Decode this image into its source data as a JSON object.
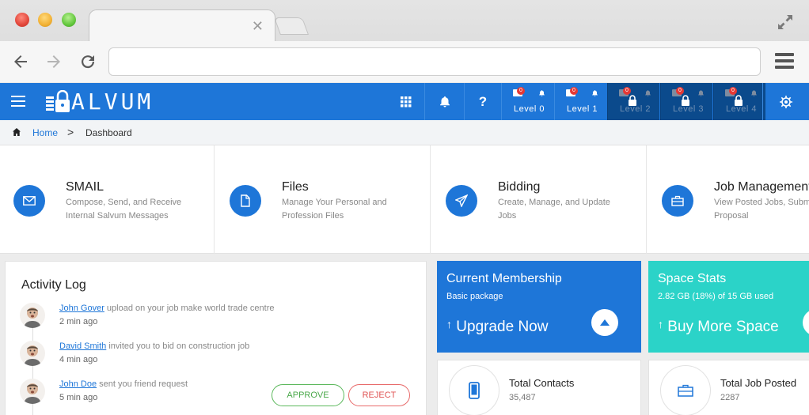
{
  "app": {
    "logo_text": "ALVUM"
  },
  "breadcrumb": {
    "home": "Home",
    "separator": ">",
    "current": "Dashboard"
  },
  "header": {
    "levels": [
      {
        "label": "Level  0",
        "badge": "0",
        "locked": false
      },
      {
        "label": "Level  1",
        "badge": "0",
        "locked": false
      },
      {
        "label": "Level  2",
        "badge": "0",
        "locked": true
      },
      {
        "label": "Level  3",
        "badge": "0",
        "locked": true
      },
      {
        "label": "Level  4",
        "badge": "0",
        "locked": true
      }
    ],
    "help_label": "?"
  },
  "quick_links": [
    {
      "title": "SMAIL",
      "desc": "Compose, Send, and Receive Internal Salvum Messages",
      "icon": "envelope-icon"
    },
    {
      "title": "Files",
      "desc": "Manage Your Personal and Profession Files",
      "icon": "file-icon"
    },
    {
      "title": "Bidding",
      "desc": "Create, Manage, and Update Jobs",
      "icon": "paper-plane-icon"
    },
    {
      "title": "Job Management",
      "desc": "View Posted Jobs, Submit Proposal",
      "icon": "briefcase-icon"
    }
  ],
  "activity": {
    "title": "Activity Log",
    "items": [
      {
        "name": "John Gover",
        "text": " upload on your job make world trade centre",
        "time": "2 min ago"
      },
      {
        "name": "David Smith",
        "text": " invited you to bid on construction job",
        "time": "4 min ago"
      },
      {
        "name": "John Doe",
        "text": " sent you friend request",
        "time": "5 min ago"
      }
    ],
    "approve_label": "APPROVE",
    "reject_label": "REJECT"
  },
  "membership": {
    "title": "Current Membership",
    "subtitle": "Basic package",
    "action": "Upgrade Now",
    "color": "#1e76d8"
  },
  "space": {
    "title": "Space Stats",
    "subtitle": "2.82 GB (18%) of 15 GB used",
    "action": "Buy More Space",
    "color": "#2bd3c8"
  },
  "contacts": {
    "title": "Total Contacts",
    "value": "35,487"
  },
  "jobs": {
    "title": "Total Job Posted",
    "value": "2287"
  }
}
